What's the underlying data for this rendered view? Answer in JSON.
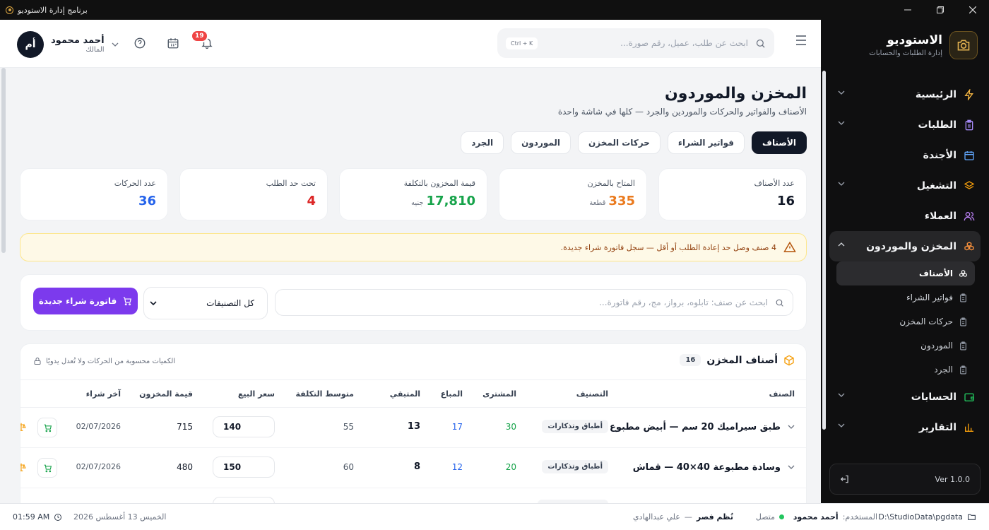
{
  "window": {
    "title": "برنامج إدارة الاستوديو"
  },
  "brand": {
    "name": "الاستوديو",
    "tagline": "إدارة الطلبات والحسابات"
  },
  "nav": {
    "home": "الرئيسية",
    "orders": "الطلبات",
    "agenda": "الأجندة",
    "operations": "التشغيل",
    "clients": "العملاء",
    "inventory": "المخزن والموردون",
    "sub": {
      "items": "الأصناف",
      "invoices": "فواتير الشراء",
      "movements": "حركات المخزن",
      "suppliers": "الموردون",
      "stocktake": "الجرد"
    },
    "accounts": "الحسابات",
    "reports": "التقارير"
  },
  "version": "Ver 1.0.0",
  "header": {
    "search_placeholder": "ابحث عن طلب، عميل، رقم صورة...",
    "shortcut": "Ctrl + K",
    "notifications_count": "19",
    "user_name": "أحمد محمود",
    "user_role": "المالك",
    "user_initials": "أم"
  },
  "page": {
    "title": "المخزن والموردون",
    "subtitle": "الأصناف والفواتير والحركات والموردين والجرد — كلها في شاشة واحدة",
    "tabs": [
      "الأصناف",
      "فواتير الشراء",
      "حركات المخزن",
      "الموردون",
      "الجرد"
    ]
  },
  "stats": [
    {
      "label": "عدد الأصناف",
      "value": "16",
      "unit": "",
      "color": "#111827"
    },
    {
      "label": "المتاح بالمخزن",
      "value": "335",
      "unit": "قطعة",
      "color": "#ea7a1e"
    },
    {
      "label": "قيمة المخزون بالتكلفة",
      "value": "17,810",
      "unit": "جنيه",
      "color": "#16a34a"
    },
    {
      "label": "تحت حد الطلب",
      "value": "4",
      "unit": "",
      "color": "#dc2626"
    },
    {
      "label": "عدد الحركات",
      "value": "36",
      "unit": "",
      "color": "#2563eb"
    }
  ],
  "alert": "4 صنف وصل حد إعادة الطلب أو أقل — سجل فاتورة شراء جديدة.",
  "toolbar": {
    "search_placeholder": "ابحث عن صنف: تابلوه، برواز، مج، رقم فاتورة...",
    "category": "كل التصنيفات",
    "new_invoice": "فاتورة شراء جديدة"
  },
  "table": {
    "title": "أصناف المخزن",
    "count": "16",
    "note": "الكميات محسوبة من الحركات ولا تُعدل يدويًا",
    "columns": [
      "الصنف",
      "التصنيف",
      "المشترى",
      "المباع",
      "المتبقي",
      "متوسط التكلفة",
      "سعر البيع",
      "قيمة المخزون",
      "آخر شراء"
    ],
    "rows": [
      {
        "name": "طبق سيراميك 20 سم — أبيض مطبوع",
        "category": "أطباق وتذكارات",
        "bought": "30",
        "sold": "17",
        "remaining": "13",
        "avg_cost": "55",
        "price": "140",
        "stock_value": "715",
        "last_purchase": "02/07/2026"
      },
      {
        "name": "وسادة مطبوعة 40×40 — قماش",
        "category": "أطباق وتذكارات",
        "bought": "20",
        "sold": "12",
        "remaining": "8",
        "avg_cost": "60",
        "price": "150",
        "stock_value": "480",
        "last_purchase": "02/07/2026"
      }
    ]
  },
  "statusbar": {
    "path": "D:\\StudioData\\pgdata",
    "user_label": "المستخدم:",
    "user": "أحمد محمود",
    "connection": "متصل",
    "shift_name": "تُظم فصر",
    "shift_sep": "—",
    "shift_user": "علي عبدالهادي",
    "date": "الخميس 13 أغسطس 2026",
    "time": "01:59 AM"
  }
}
